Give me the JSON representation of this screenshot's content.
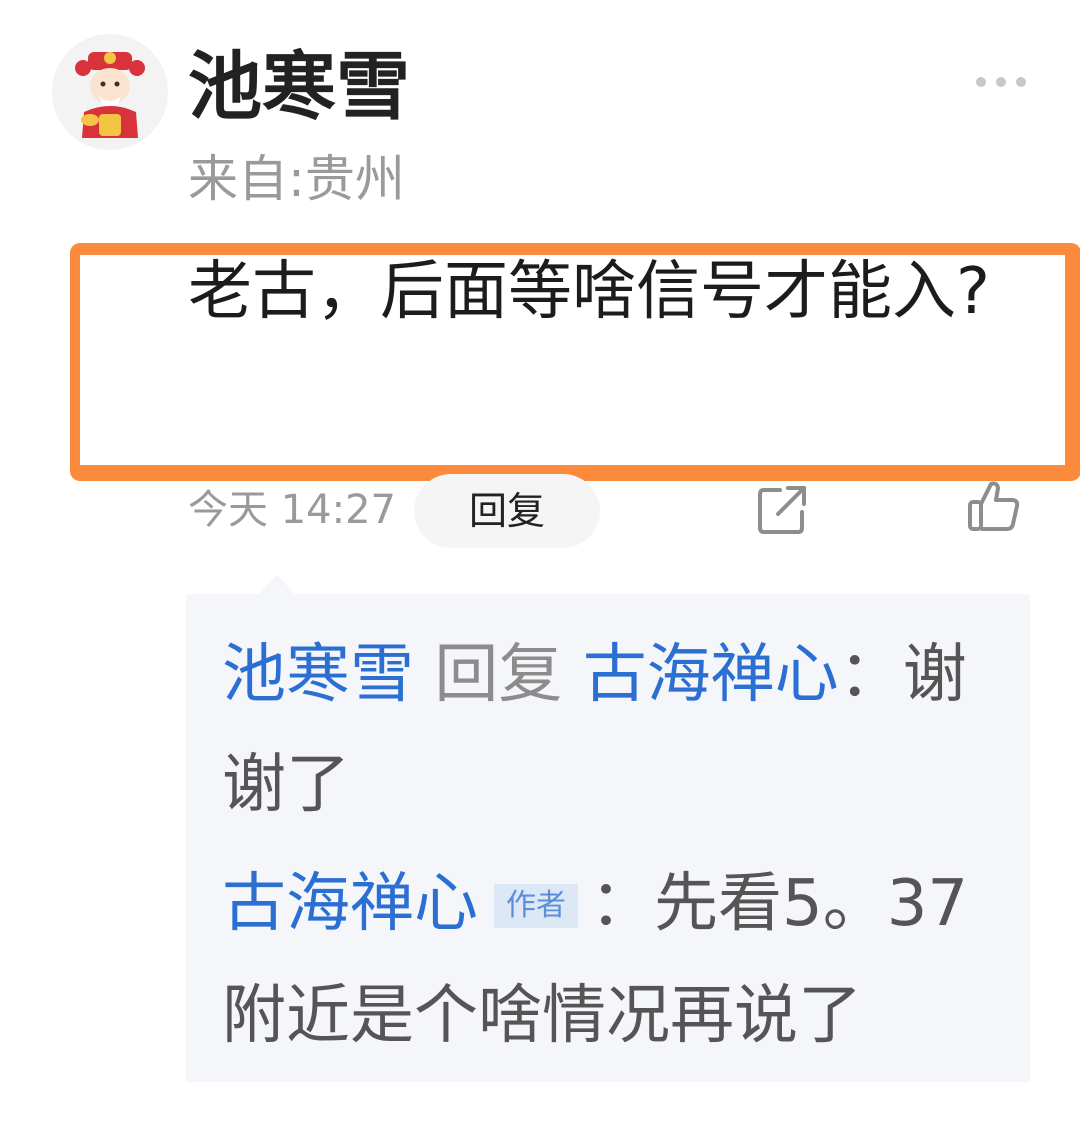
{
  "comment": {
    "username": "池寒雪",
    "location": "来自:贵州",
    "text": "老古，后面等啥信号才能入?",
    "time": "今天 14:27",
    "reply_label": "回复"
  },
  "icons": {
    "avatar": "avatar-god-of-wealth",
    "more": "more-dots-icon",
    "share": "share-icon",
    "like": "thumbs-up-icon"
  },
  "replies": [
    {
      "from": "池寒雪",
      "action": "回复",
      "to": "古海禅心",
      "separator": "：",
      "text": "谢谢了"
    },
    {
      "from": "古海禅心",
      "tag": "作者",
      "separator": "：",
      "text": "先看5。37附近是个啥情况再说了"
    }
  ],
  "colors": {
    "username_link": "#2a6fd1",
    "highlight_border": "#fb8a3c",
    "reply_panel_bg": "#f5f6fa",
    "meta_text": "#9a9a9a"
  }
}
